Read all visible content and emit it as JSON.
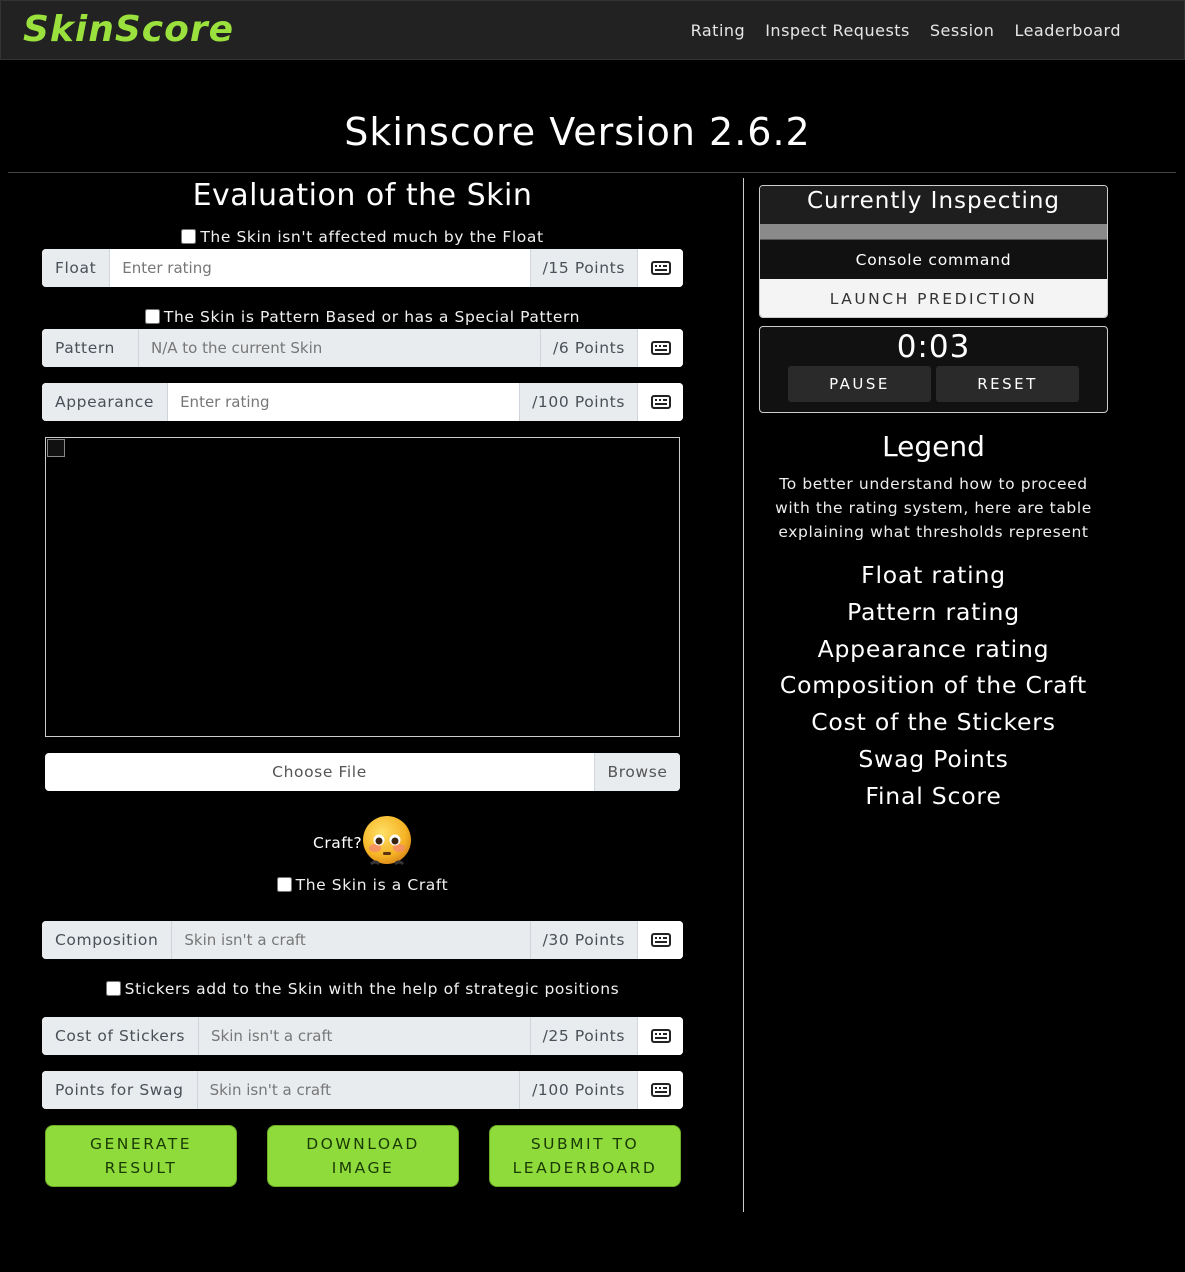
{
  "navbar": {
    "brand": "SkinScore",
    "links": [
      "Rating",
      "Inspect Requests",
      "Session",
      "Leaderboard"
    ]
  },
  "page_title": "Skinscore Version 2.6.2",
  "evaluation": {
    "title": "Evaluation of the Skin",
    "float_check": "The Skin isn't affected much by the Float",
    "float": {
      "label": "Float",
      "placeholder": "Enter rating",
      "points": "/15 Points"
    },
    "pattern_check": "The Skin is Pattern Based or has a Special Pattern",
    "pattern": {
      "label": "Pattern",
      "placeholder": "N/A to the current Skin",
      "points": "/6 Points"
    },
    "appearance": {
      "label": "Appearance",
      "placeholder": "Enter rating",
      "points": "/100 Points"
    },
    "file": {
      "choose": "Choose File",
      "browse": "Browse"
    },
    "craft_question": "Craft?",
    "craft_check": "The Skin is a Craft",
    "composition": {
      "label": "Composition",
      "placeholder": "Skin isn't a craft",
      "points": "/30 Points"
    },
    "stickers_check": "Stickers add to the Skin with the help of strategic positions",
    "stickers": {
      "label": "Cost of Stickers",
      "placeholder": "Skin isn't a craft",
      "points": "/25 Points"
    },
    "swag": {
      "label": "Points for Swag",
      "placeholder": "Skin isn't a craft",
      "points": "/100 Points"
    },
    "buttons": {
      "generate": "GENERATE RESULT",
      "download": "DOWNLOAD IMAGE",
      "submit": "SUBMIT TO LEADERBOARD"
    }
  },
  "inspect": {
    "title": "Currently Inspecting",
    "console": "Console command",
    "launch": "LAUNCH PREDICTION"
  },
  "timer": {
    "value": "0:03",
    "pause": "PAUSE",
    "reset": "RESET"
  },
  "legend": {
    "title": "Legend",
    "text": "To better understand how to proceed with the rating system, here are table explaining what thresholds represent",
    "items": [
      "Float rating",
      "Pattern rating",
      "Appearance rating",
      "Composition of the Craft",
      "Cost of the Stickers",
      "Swag Points",
      "Final Score"
    ]
  },
  "colors": {
    "accent": "#8fdb3b",
    "brand": "#9be13d",
    "background": "#000000"
  },
  "icons": {
    "input_addon": "keyboard-icon",
    "emoji": "flushed-face-icon"
  }
}
